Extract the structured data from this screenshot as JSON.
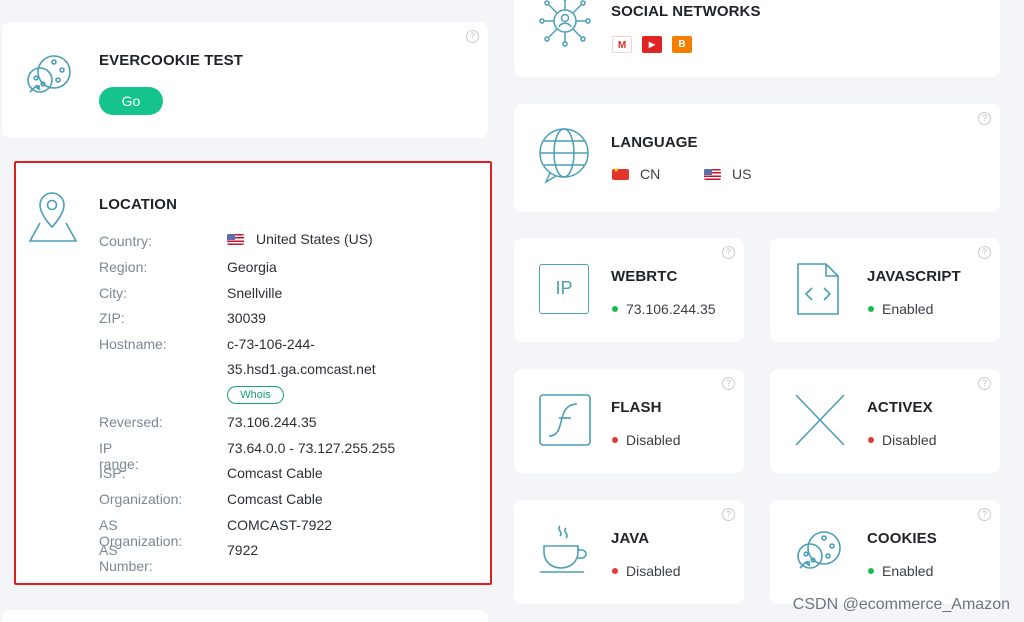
{
  "help_glyph": "?",
  "evercookie": {
    "title": "EVERCOOKIE TEST",
    "button": "Go"
  },
  "location": {
    "title": "LOCATION",
    "rows": [
      {
        "label": "Country:",
        "value": "United States (US)"
      },
      {
        "label": "Region:",
        "value": "Georgia"
      },
      {
        "label": "City:",
        "value": "Snellville"
      },
      {
        "label": "ZIP:",
        "value": "30039"
      },
      {
        "label": "Hostname:",
        "value": "c-73-106-244-",
        "value2": "35.hsd1.ga.comcast.net"
      },
      {
        "label": "Reversed:",
        "value": "73.106.244.35"
      },
      {
        "label": "IP range:",
        "value": "73.64.0.0 - 73.127.255.255"
      },
      {
        "label": "ISP:",
        "value": "Comcast Cable"
      },
      {
        "label": "Organization:",
        "value": "Comcast Cable"
      },
      {
        "label": "AS Organization:",
        "value": "COMCAST-7922"
      },
      {
        "label": "AS Number:",
        "value": "7922"
      }
    ],
    "whois": "Whois"
  },
  "social": {
    "title": "SOCIAL NETWORKS",
    "badges": [
      "M",
      "▶",
      "B"
    ]
  },
  "language": {
    "title": "LANGUAGE",
    "items": [
      "CN",
      "US"
    ]
  },
  "webrtc": {
    "title": "WEBRTC",
    "value": "73.106.244.35",
    "icon_text": "IP"
  },
  "javascript": {
    "title": "JAVASCRIPT",
    "value": "Enabled"
  },
  "flash": {
    "title": "FLASH",
    "value": "Disabled"
  },
  "activex": {
    "title": "ACTIVEX",
    "value": "Disabled"
  },
  "java": {
    "title": "JAVA",
    "value": "Disabled"
  },
  "cookies": {
    "title": "COOKIES",
    "value": "Enabled"
  },
  "watermark": "CSDN @ecommerce_Amazon",
  "colors": {
    "accent": "#14c48c",
    "enabled": "#1db954",
    "disabled": "#e53935",
    "icon_stroke": "#4a9fb5",
    "highlight_border": "#e02020"
  }
}
